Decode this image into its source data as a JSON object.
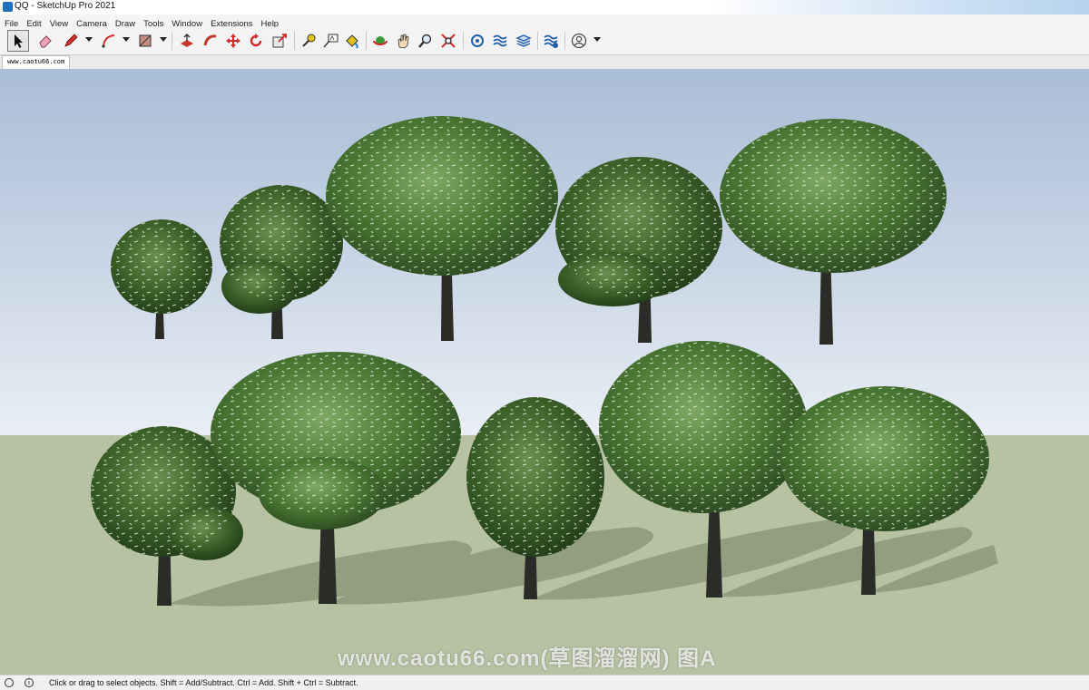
{
  "window": {
    "title": "QQ - SketchUp Pro 2021"
  },
  "menu": [
    "File",
    "Edit",
    "View",
    "Camera",
    "Draw",
    "Tools",
    "Window",
    "Extensions",
    "Help"
  ],
  "tools": [
    {
      "name": "select-tool-icon"
    },
    {
      "name": "eraser-tool-icon"
    },
    {
      "name": "pencil-tool-icon"
    },
    {
      "name": "arc-tool-icon"
    },
    {
      "name": "shape-tool-icon"
    },
    {
      "name": "push-pull-tool-icon"
    },
    {
      "name": "follow-me-tool-icon"
    },
    {
      "name": "move-tool-icon"
    },
    {
      "name": "rotate-tool-icon"
    },
    {
      "name": "scale-tool-icon"
    },
    {
      "name": "tape-measure-tool-icon"
    },
    {
      "name": "text-tool-icon"
    },
    {
      "name": "paint-bucket-tool-icon"
    },
    {
      "name": "orbit-tool-icon"
    },
    {
      "name": "pan-tool-icon"
    },
    {
      "name": "zoom-tool-icon"
    },
    {
      "name": "zoom-extents-tool-icon"
    },
    {
      "name": "warehouse-icon"
    },
    {
      "name": "extension-warehouse-icon"
    },
    {
      "name": "layout-icon"
    },
    {
      "name": "extension-manager-icon"
    },
    {
      "name": "account-icon"
    }
  ],
  "scene_tab": {
    "label": "www.caotu66.com"
  },
  "watermark": {
    "text": "www.caotu66.com(草图溜溜网) 图A"
  },
  "status": {
    "message": "Click or drag to select objects. Shift = Add/Subtract. Ctrl = Add. Shift + Ctrl = Subtract."
  },
  "colors": {
    "foliage_dark": "#2f4f23",
    "foliage": "#4c7a34",
    "foliage_light": "#7ea864",
    "trunk": "#2b2b28",
    "ground": "#b7c2a3",
    "sky_top": "#a9bdd6"
  }
}
